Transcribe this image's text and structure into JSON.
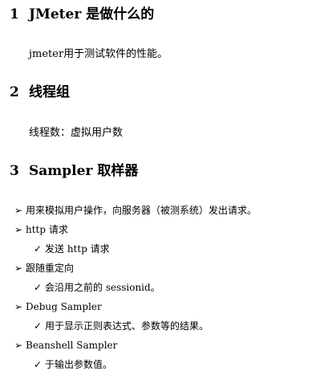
{
  "sections": [
    {
      "number": "1",
      "title": "JMeter 是做什么的",
      "paragraph": "jmeter用于测试软件的性能。"
    },
    {
      "number": "2",
      "title": "线程组",
      "paragraph": "线程数：虚拟用户数"
    },
    {
      "number": "3",
      "title": "Sampler 取样器",
      "bullets": [
        {
          "mark": "➢",
          "text": "用来模拟用户操作，向服务器（被测系统）发出请求。"
        },
        {
          "mark": "➢",
          "text": "http 请求",
          "sub": {
            "mark": "✓",
            "text": "发送 http 请求"
          }
        },
        {
          "mark": "➢",
          "text": "跟随重定向",
          "sub": {
            "mark": "✓",
            "text": "会沿用之前的 sessionid。"
          }
        },
        {
          "mark": "➢",
          "text": "Debug Sampler",
          "sub": {
            "mark": "✓",
            "text": "用于显示正则表达式、参数等的结果。"
          }
        },
        {
          "mark": "➢",
          "text": "Beanshell Sampler",
          "sub": {
            "mark": "✓",
            "text": "于输出参数值。"
          }
        }
      ]
    }
  ]
}
